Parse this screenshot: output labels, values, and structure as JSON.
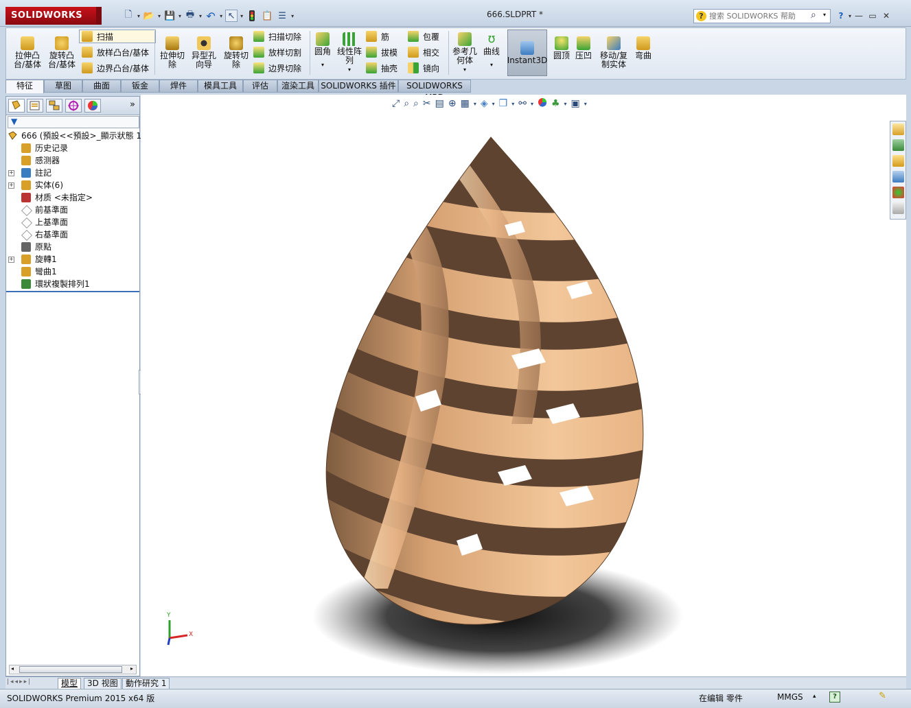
{
  "app": {
    "brand": "SOLIDWORKS",
    "document_title": "666.SLDPRT *"
  },
  "search": {
    "placeholder": "搜索 SOLIDWORKS 帮助"
  },
  "command_manager": {
    "extrude_boss": "拉伸凸\n台/基体",
    "revolve_boss": "旋转凸\n台/基体",
    "sweep": "扫描",
    "loft_boss": "放样凸台/基体",
    "boundary_boss": "边界凸台/基体",
    "extrude_cut": "拉伸切\n除",
    "hole_wizard": "异型孔\n向导",
    "revolve_cut": "旋转切\n除",
    "sweep_cut": "扫描切除",
    "loft_cut": "放样切割",
    "boundary_cut": "边界切除",
    "fillet": "圆角",
    "linear_pattern": "线性阵\n列",
    "rib": "筋",
    "draft": "拔模",
    "shell": "抽壳",
    "wrap": "包覆",
    "intersect": "相交",
    "mirror": "镜向",
    "reference_geometry": "参考几\n何体",
    "curves": "曲线",
    "instant3d": "Instant3D",
    "dome": "圆顶",
    "indent": "压凹",
    "move_copy_body": "移动/复\n制实体",
    "flex": "弯曲"
  },
  "tabs": [
    "特征",
    "草图",
    "曲面",
    "钣金",
    "焊件",
    "模具工具",
    "评估",
    "渲染工具",
    "SOLIDWORKS 插件",
    "SOLIDWORKS MBD"
  ],
  "feature_tree": {
    "root": "666  (預設<<預設>_顯示狀態 1",
    "items": [
      {
        "label": "历史记录",
        "expandable": false
      },
      {
        "label": "感测器",
        "expandable": false
      },
      {
        "label": "註記",
        "expandable": true
      },
      {
        "label": "实体(6)",
        "expandable": true
      },
      {
        "label": "材质 <未指定>",
        "expandable": false
      },
      {
        "label": "前基準面",
        "expandable": false
      },
      {
        "label": "上基準面",
        "expandable": false
      },
      {
        "label": "右基準面",
        "expandable": false
      },
      {
        "label": "原點",
        "expandable": false
      },
      {
        "label": "旋轉1",
        "expandable": true
      },
      {
        "label": "彎曲1",
        "expandable": false
      },
      {
        "label": "環狀複製排列1",
        "expandable": false
      }
    ]
  },
  "bottom_tabs": [
    "模型",
    "3D 视图",
    "動作研究 1"
  ],
  "status": {
    "product": "SOLIDWORKS Premium 2015 x64 版",
    "editing": "在编辑 零件",
    "units": "MMGS"
  },
  "triad": {
    "y": "Y",
    "x": "X"
  },
  "colors": {
    "model_light": "#f2c79a",
    "model_mid": "#d7a273",
    "model_dark": "#8a6446",
    "accent_red": "#b5121b"
  }
}
